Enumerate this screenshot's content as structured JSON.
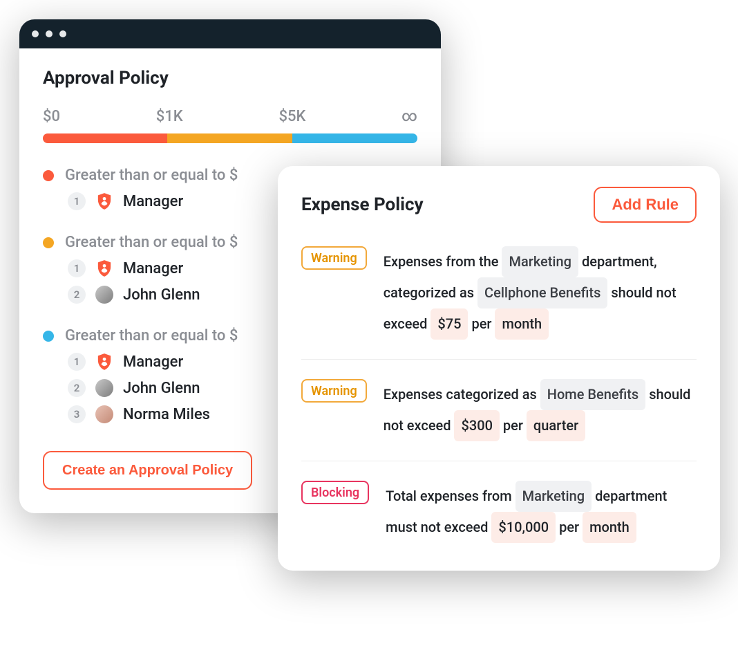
{
  "approval": {
    "title": "Approval Policy",
    "range_labels": [
      "$0",
      "$1K",
      "$5K",
      "∞"
    ],
    "tier_label": "Greater than or equal to $",
    "tiers": [
      {
        "color": "red",
        "approvers": [
          {
            "num": "1",
            "type": "role",
            "label": "Manager"
          }
        ]
      },
      {
        "color": "orange",
        "approvers": [
          {
            "num": "1",
            "type": "role",
            "label": "Manager"
          },
          {
            "num": "2",
            "type": "user",
            "label": "John Glenn",
            "avatar": "male"
          }
        ]
      },
      {
        "color": "blue",
        "approvers": [
          {
            "num": "1",
            "type": "role",
            "label": "Manager"
          },
          {
            "num": "2",
            "type": "user",
            "label": "John Glenn",
            "avatar": "male"
          },
          {
            "num": "3",
            "type": "user",
            "label": "Norma Miles",
            "avatar": "female"
          }
        ]
      }
    ],
    "create_button": "Create an Approval Policy"
  },
  "expense": {
    "title": "Expense Policy",
    "add_button": "Add Rule",
    "tag_warning": "Warning",
    "tag_blocking": "Blocking",
    "rules": [
      {
        "severity": "warning",
        "parts": [
          {
            "t": "text",
            "v": "Expenses from the "
          },
          {
            "t": "chip",
            "v": "Marketing"
          },
          {
            "t": "text",
            "v": " department, categorized as "
          },
          {
            "t": "chip",
            "v": "Cellphone Benefits"
          },
          {
            "t": "text",
            "v": " should not exceed "
          },
          {
            "t": "amount",
            "v": "$75"
          },
          {
            "t": "text",
            "v": " per "
          },
          {
            "t": "period",
            "v": "month"
          }
        ]
      },
      {
        "severity": "warning",
        "parts": [
          {
            "t": "text",
            "v": "Expenses categorized as "
          },
          {
            "t": "chip",
            "v": "Home Benefits"
          },
          {
            "t": "text",
            "v": " should not exceed "
          },
          {
            "t": "amount",
            "v": "$300"
          },
          {
            "t": "text",
            "v": " per "
          },
          {
            "t": "period",
            "v": "quarter"
          }
        ]
      },
      {
        "severity": "blocking",
        "parts": [
          {
            "t": "text",
            "v": "Total expenses from "
          },
          {
            "t": "chip",
            "v": "Marketing"
          },
          {
            "t": "text",
            "v": " department must not exceed "
          },
          {
            "t": "amount",
            "v": "$10,000"
          },
          {
            "t": "text",
            "v": " per "
          },
          {
            "t": "period",
            "v": "month"
          }
        ]
      }
    ]
  }
}
